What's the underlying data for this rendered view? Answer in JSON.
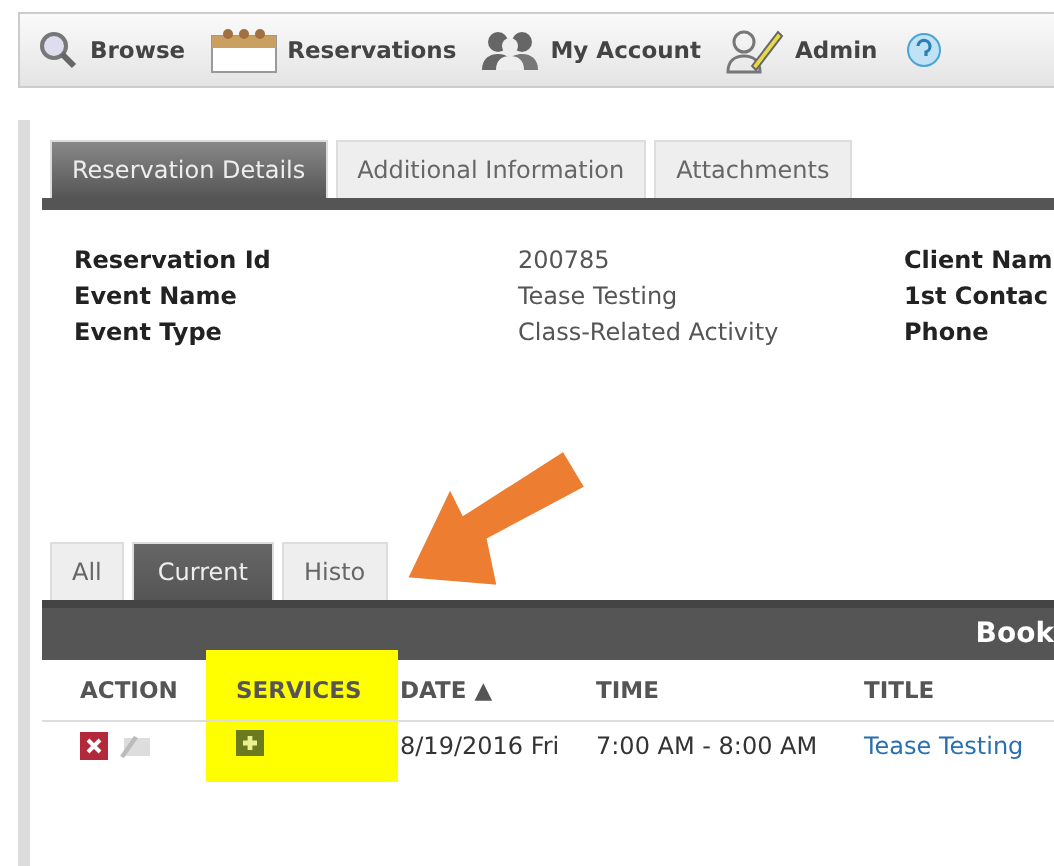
{
  "toolbar": [
    {
      "label": "Browse",
      "kind": "search"
    },
    {
      "label": "Reservations",
      "kind": "calendar"
    },
    {
      "label": "My Account",
      "kind": "people"
    },
    {
      "label": "Admin",
      "kind": "pencil"
    },
    {
      "kind": "help"
    }
  ],
  "tabs": [
    {
      "label": "Reservation Details",
      "selected": true
    },
    {
      "label": "Additional Information",
      "selected": false
    },
    {
      "label": "Attachments",
      "selected": false
    }
  ],
  "details": [
    {
      "label": "Reservation Id",
      "value": "200785",
      "label_2": "Client Nam"
    },
    {
      "label": "Event Name",
      "value": "Tease Testing",
      "label_2": "1st Contac"
    },
    {
      "label": "Event Type",
      "value": "Class-Related Activity",
      "label_2": "Phone"
    }
  ],
  "booking_tabs": [
    {
      "label": "All",
      "selected": false
    },
    {
      "label": "Current",
      "selected": true
    },
    {
      "label": "Histo",
      "selected": false
    }
  ],
  "bookings": {
    "title": "Book",
    "columns": [
      "ACTION",
      "SERVICES",
      "DATE ▲",
      "TIME",
      "TITLE"
    ],
    "rows": [
      {
        "date": "8/19/2016 Fri",
        "time": "7:00 AM - 8:00 AM",
        "title": "Tease Testing"
      }
    ]
  }
}
